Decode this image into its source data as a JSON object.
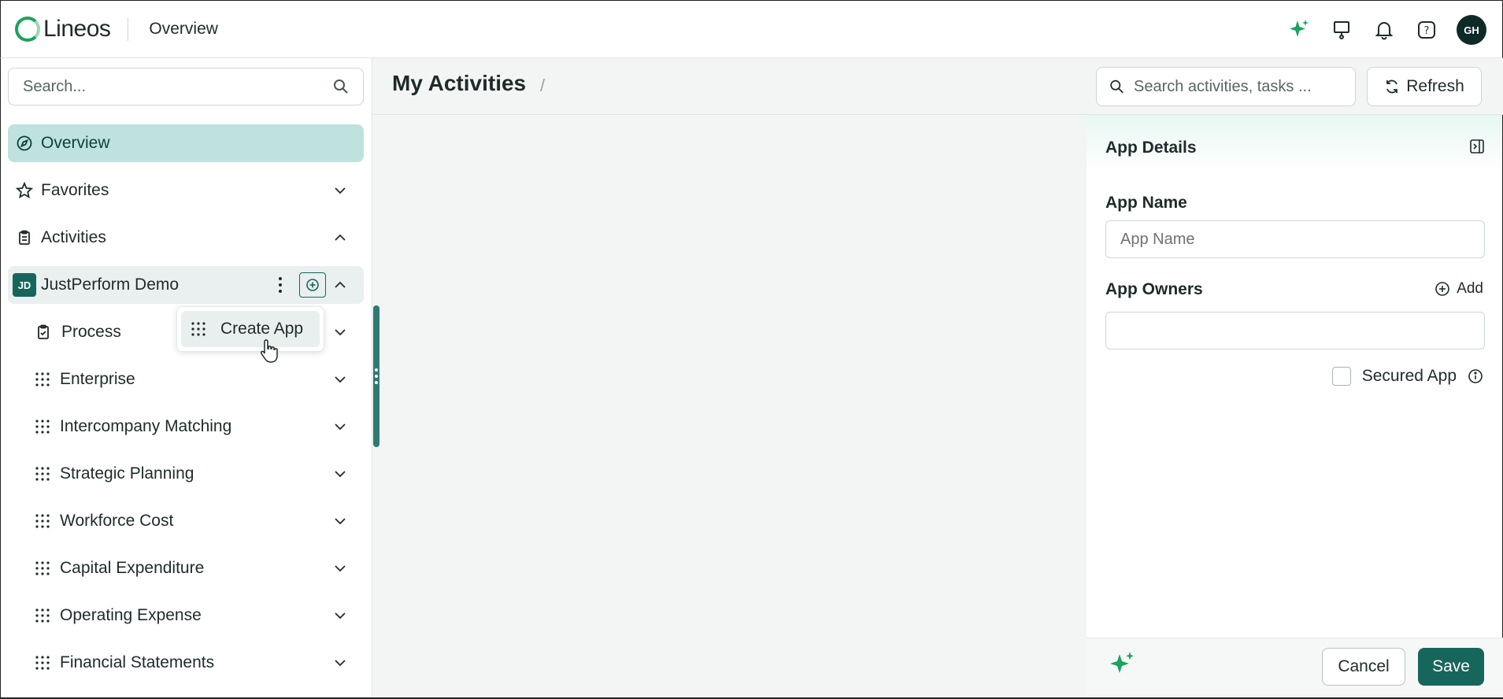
{
  "app": {
    "logo_text": "Lineos",
    "page_title": "Overview",
    "avatar_initials": "GH"
  },
  "colors": {
    "accent": "#17665c",
    "brand_green": "#1aa35c",
    "active_bg": "#bfe2de"
  },
  "sidebar": {
    "search_placeholder": "Search...",
    "overview": "Overview",
    "favorites": "Favorites",
    "activities": "Activities",
    "workspace": {
      "badge": "JD",
      "label": "JustPerform Demo"
    },
    "apps": [
      {
        "label": "Process",
        "icon": "clipboard-icon"
      },
      {
        "label": "Enterprise",
        "icon": "grid-icon"
      },
      {
        "label": "Intercompany Matching",
        "icon": "grid-icon"
      },
      {
        "label": "Strategic Planning",
        "icon": "grid-icon"
      },
      {
        "label": "Workforce Cost",
        "icon": "grid-icon"
      },
      {
        "label": "Capital Expenditure",
        "icon": "grid-icon"
      },
      {
        "label": "Operating Expense",
        "icon": "grid-icon"
      },
      {
        "label": "Financial Statements",
        "icon": "grid-icon"
      }
    ],
    "create_app": "Create App"
  },
  "main": {
    "title": "My Activities",
    "separator": "/",
    "search_placeholder": "Search activities, tasks ...",
    "refresh": "Refresh"
  },
  "panel": {
    "title": "App Details",
    "app_name_label": "App Name",
    "app_name_placeholder": "App Name",
    "app_owners_label": "App Owners",
    "add": "Add",
    "secured_app": "Secured App",
    "cancel": "Cancel",
    "save": "Save"
  }
}
